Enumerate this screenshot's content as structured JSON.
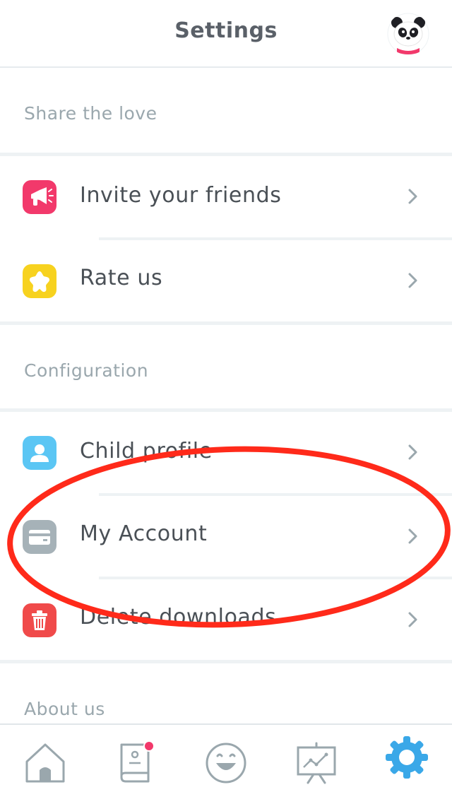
{
  "header": {
    "title": "Settings"
  },
  "sections": {
    "share": {
      "label": "Share the love"
    },
    "config": {
      "label": "Configuration"
    },
    "about": {
      "label": "About us"
    }
  },
  "rows": {
    "invite": {
      "label": "Invite your friends",
      "icon": "megaphone-icon",
      "color": "#f2396b"
    },
    "rate": {
      "label": "Rate us",
      "icon": "star-icon",
      "color": "#f7d21f"
    },
    "child": {
      "label": "Child profile",
      "icon": "user-icon",
      "color": "#5bc6f4"
    },
    "account": {
      "label": "My Account",
      "icon": "card-icon",
      "color": "#a6b2b8"
    },
    "delete": {
      "label": "Delete downloads",
      "icon": "trash-icon",
      "color": "#f04a4a"
    }
  },
  "tabbar": {
    "tabs": [
      {
        "name": "home",
        "icon": "home-icon",
        "active": false
      },
      {
        "name": "book",
        "icon": "book-icon",
        "active": false,
        "badge": true
      },
      {
        "name": "smile",
        "icon": "smile-icon",
        "active": false
      },
      {
        "name": "stats",
        "icon": "chart-board-icon",
        "active": false
      },
      {
        "name": "settings",
        "icon": "gear-icon",
        "active": true
      }
    ],
    "active_color": "#3aa8e8",
    "inactive_color": "#9aa7ad",
    "badge_color": "#f2396b"
  },
  "annotation": {
    "color": "#ff2a1a",
    "shape": "ellipse-around-my-account"
  }
}
